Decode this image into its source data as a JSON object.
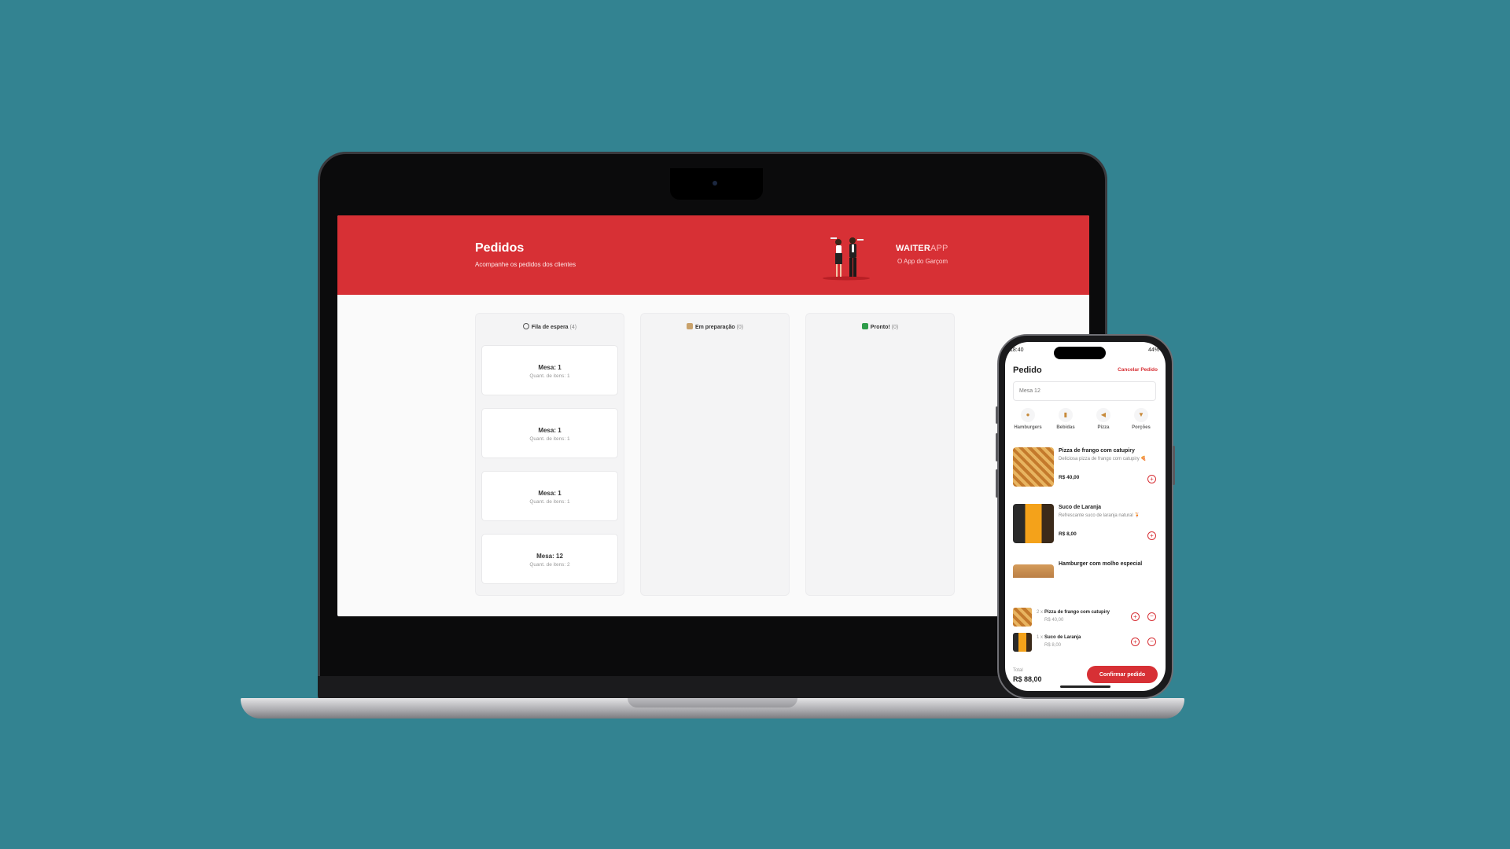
{
  "web": {
    "header": {
      "title": "Pedidos",
      "subtitle": "Acompanhe os pedidos dos clientes",
      "brand_main": "WAITER",
      "brand_accent": "APP",
      "brand_tagline": "O App do Garçom"
    },
    "columns": [
      {
        "icon": "clock-icon",
        "title": "Fila de espera",
        "count": "(4)",
        "orders": [
          {
            "table": "Mesa: 1",
            "quantity": "Quant. de itens: 1"
          },
          {
            "table": "Mesa: 1",
            "quantity": "Quant. de itens: 1"
          },
          {
            "table": "Mesa: 1",
            "quantity": "Quant. de itens: 1"
          },
          {
            "table": "Mesa: 12",
            "quantity": "Quant. de itens: 2"
          }
        ]
      },
      {
        "icon": "chef-icon",
        "title": "Em preparação",
        "count": "(0)",
        "orders": []
      },
      {
        "icon": "check-icon",
        "title": "Pronto!",
        "count": "(0)",
        "orders": []
      }
    ]
  },
  "mobile": {
    "status": {
      "time": "18:40",
      "battery": "44%"
    },
    "title": "Pedido",
    "cancel_label": "Cancelar Pedido",
    "table_value": "Mesa 12",
    "categories": [
      {
        "icon": "burger-icon",
        "label": "Hamburgers"
      },
      {
        "icon": "drink-icon",
        "label": "Bebidas"
      },
      {
        "icon": "pizza-icon",
        "label": "Pizza"
      },
      {
        "icon": "fries-icon",
        "label": "Porções"
      }
    ],
    "products": [
      {
        "name": "Pizza de frango com catupiry",
        "description": "Deliciosa pizza de frango com catupiry 🍕",
        "price": "R$ 40,00"
      },
      {
        "name": "Suco de Laranja",
        "description": "Refrescante suco de laranja natural 🍹",
        "price": "R$ 8,00"
      },
      {
        "name": "Hamburger com molho especial",
        "description": "",
        "price": ""
      }
    ],
    "cart": [
      {
        "quantity": "2 x",
        "name": "Pizza de frango com catupiry",
        "price": "R$ 40,00"
      },
      {
        "quantity": "1 x",
        "name": "Suco de Laranja",
        "price": "R$ 8,00"
      }
    ],
    "total_label": "Total",
    "total_value": "R$ 88,00",
    "confirm_label": "Confirmar pedido"
  },
  "colors": {
    "background": "#338391",
    "brand_red": "#d73035"
  }
}
